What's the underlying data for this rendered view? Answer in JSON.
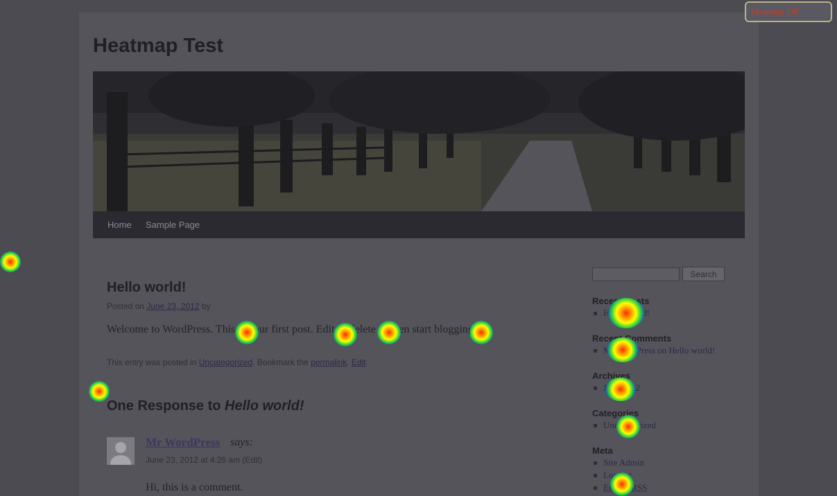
{
  "site": {
    "title": "Heatmap Test"
  },
  "nav": [
    "Home",
    "Sample Page"
  ],
  "post": {
    "title": "Hello world!",
    "posted_on": "Posted on",
    "date": "June 23, 2012",
    "by": "by",
    "content": "Welcome to WordPress. This is your first post. Edit or delete it, then start blogging!",
    "footer_prefix": "This entry was posted in",
    "category": "Uncategorized",
    "bookmark": ". Bookmark the",
    "permalink": "permalink",
    "separator": ".",
    "edit": "Edit"
  },
  "comments": {
    "title_prefix": "One Response to ",
    "title_em": "Hello world!",
    "author": "Mr WordPress",
    "says": "says:",
    "meta": "June 23, 2012 at 4:26 am (Edit)",
    "text": "Hi, this is a comment."
  },
  "sidebar": {
    "search_button": "Search",
    "recent_posts": {
      "title": "Recent Posts",
      "items": [
        "Hello world!"
      ]
    },
    "recent_comments": {
      "title": "Recent Comments",
      "author": "Mr WordPress",
      "on": " on ",
      "post": "Hello world!"
    },
    "archives": {
      "title": "Archives",
      "items": [
        "June 2012"
      ]
    },
    "categories": {
      "title": "Categories",
      "items": [
        "Uncategorized"
      ]
    },
    "meta": {
      "title": "Meta",
      "items": [
        "Site Admin",
        "Log out",
        "Entries RSS"
      ]
    }
  },
  "heatmap_toggle": "Heatmap Off",
  "colors": {
    "overlay": "#4c4b52",
    "toggle_text": "#d23a1e",
    "heat_hot": "#ff2a00",
    "heat_cold": "#1c3dd8"
  }
}
